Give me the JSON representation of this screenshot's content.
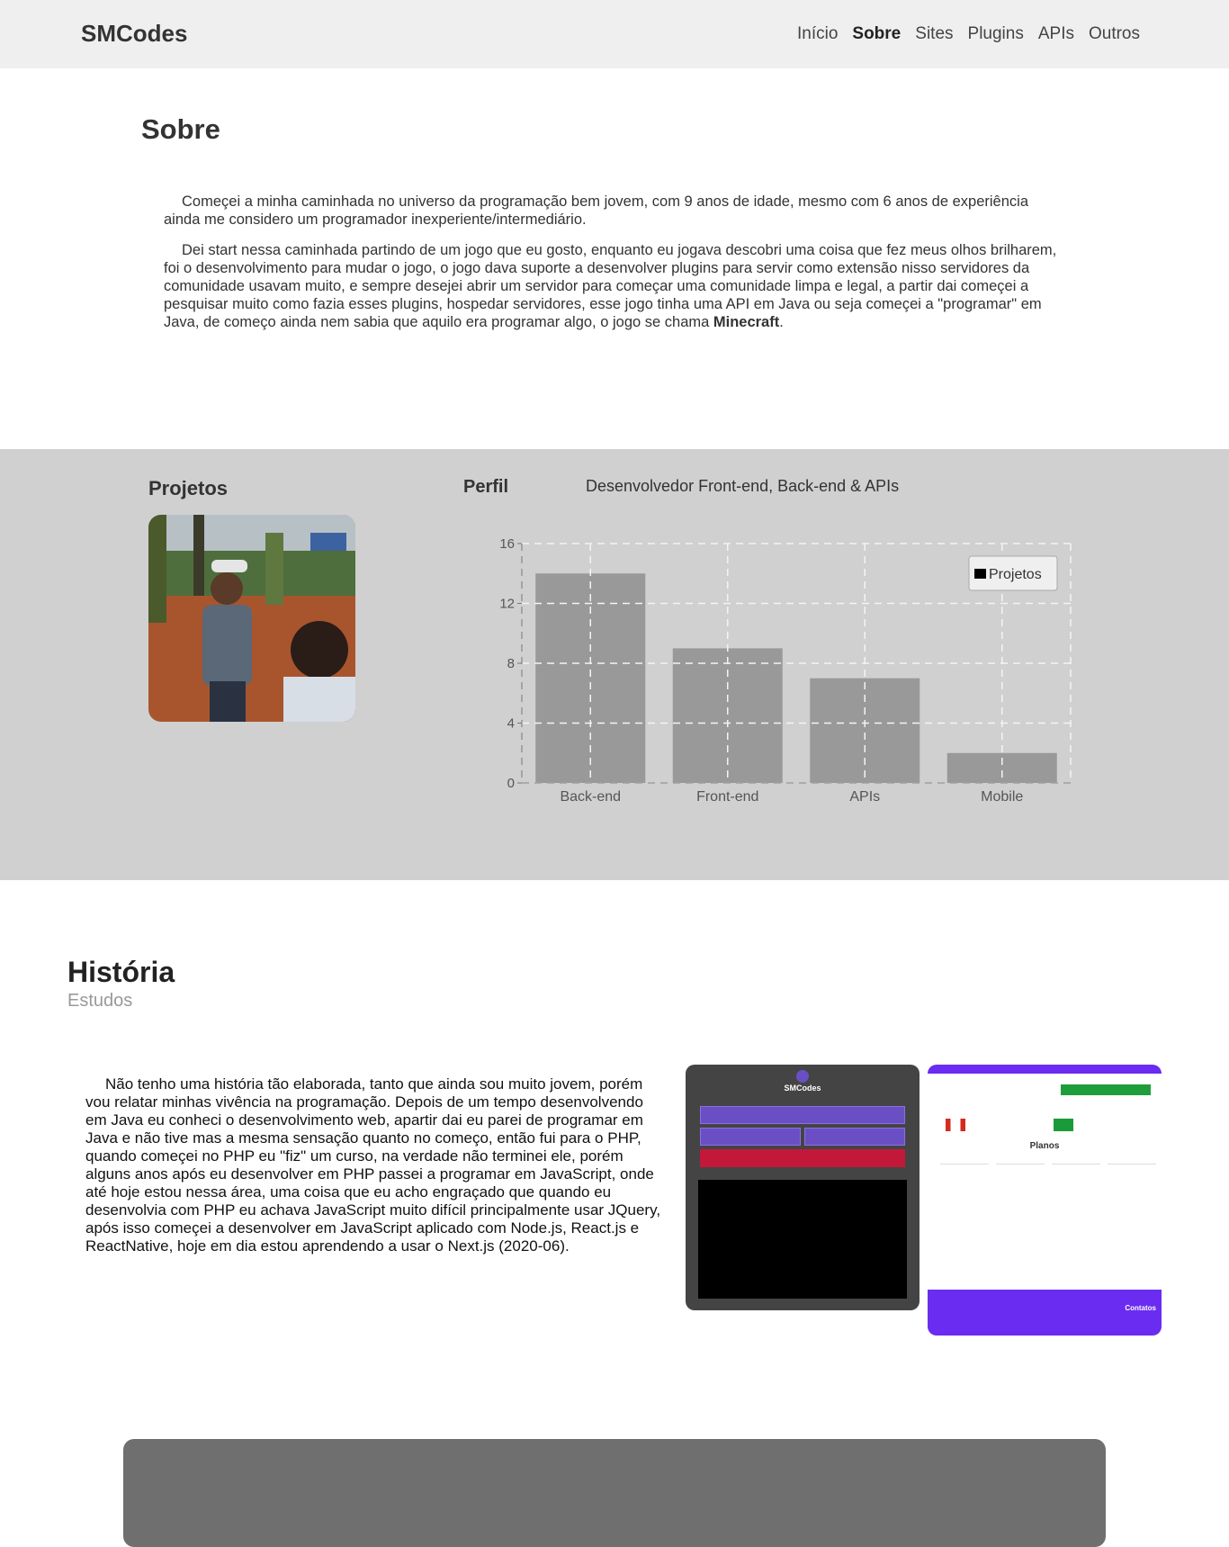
{
  "header": {
    "brand": "SMCodes",
    "nav": [
      "Início",
      "Sobre",
      "Sites",
      "Plugins",
      "APIs",
      "Outros"
    ],
    "active": "Sobre"
  },
  "sobre": {
    "title": "Sobre",
    "p1": "Começei a minha caminhada no universo da programação bem jovem, com 9 anos de idade, mesmo com 6 anos de experiência ainda me considero um programador inexperiente/intermediário.",
    "p2_before": "Dei start nessa caminhada partindo de um jogo que eu gosto, enquanto eu jogava descobri uma coisa que fez meus olhos brilharem, foi o desenvolvimento para mudar o jogo, o jogo dava suporte a desenvolver plugins para servir como extensão nisso servidores da comunidade usavam muito, e sempre desejei abrir um servidor para começar uma comunidade limpa e legal, a partir dai começei a pesquisar muito como fazia esses plugins, hospedar servidores, esse jogo tinha uma API em Java ou seja começei a \"programar\" em Java, de começo ainda nem sabia que aquilo era programar algo, o jogo se chama ",
    "p2_bold": "Minecraft",
    "p2_after": "."
  },
  "projetos": {
    "title": "Projetos"
  },
  "perfil": {
    "title": "Perfil",
    "description": "Desenvolvedor Front-end, Back-end & APIs"
  },
  "chart_data": {
    "type": "bar",
    "categories": [
      "Back-end",
      "Front-end",
      "APIs",
      "Mobile"
    ],
    "series": [
      {
        "name": "Projetos",
        "values": [
          14,
          9,
          7,
          2
        ]
      }
    ],
    "ylim": [
      0,
      16
    ],
    "yticks": [
      0,
      4,
      8,
      12,
      16
    ],
    "grid": true,
    "legend_position": "top-right",
    "bar_color": "#999999"
  },
  "historia": {
    "title": "História",
    "subtitle": "Estudos",
    "text": "Não tenho uma história tão elaborada, tanto que ainda sou muito jovem, porém vou relatar minhas vivência na programação. Depois de um tempo desenvolvendo em Java eu conheci o desenvolvimento web, apartir dai eu parei de programar em Java e não tive mas a mesma sensação quanto no começo, então fui para o PHP, quando começei no PHP eu \"fiz\" um curso, na verdade não terminei ele, porém alguns anos após eu desenvolver em PHP passei a programar em JavaScript, onde até hoje estou nessa área, uma coisa que eu acho engraçado que quando eu desenvolvia com PHP eu achava JavaScript muito difícil principalmente usar JQuery, após isso começei a desenvolver em JavaScript aplicado com Node.js, React.js e ReactNative, hoje em dia estou aprendendo a usar o Next.js (2020-06).",
    "shot1_title": "SMCodes",
    "shot2_planos": "Planos",
    "shot2_contatos": "Contatos"
  }
}
